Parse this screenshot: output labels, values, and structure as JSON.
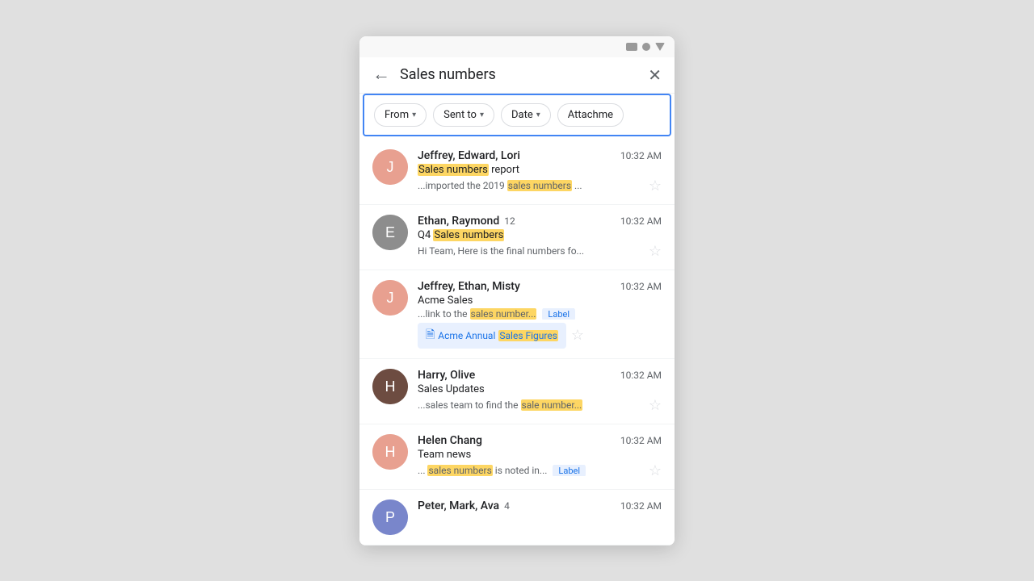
{
  "statusBar": {
    "icons": [
      "rect",
      "circle",
      "triangle"
    ]
  },
  "searchBar": {
    "backLabel": "←",
    "searchText": "Sales numbers",
    "closeLabel": "✕"
  },
  "filterBar": {
    "filters": [
      {
        "label": "From",
        "id": "from"
      },
      {
        "label": "Sent to",
        "id": "sent-to"
      },
      {
        "label": "Date",
        "id": "date"
      },
      {
        "label": "Attachments",
        "id": "attachments"
      }
    ]
  },
  "emails": [
    {
      "id": 1,
      "avatarClass": "avatar-jel",
      "avatarLabel": "J",
      "sender": "Jeffrey, Edward, Lori",
      "count": null,
      "time": "10:32 AM",
      "subject": "Sales numbers report",
      "subjectHighlight": "Sales numbers",
      "subjectRest": " report",
      "preview": "...imported the 2019 ",
      "previewHighlight": "sales numbers",
      "previewRest": "...",
      "labelChip": null,
      "attachment": null,
      "starred": false
    },
    {
      "id": 2,
      "avatarClass": "avatar-er",
      "avatarLabel": "E",
      "sender": "Ethan, Raymond",
      "count": "12",
      "time": "10:32 AM",
      "subject": "Q4 Sales numbers",
      "subjectPrefix": "Q4 ",
      "subjectHighlight": "Sales numbers",
      "subjectRest": "",
      "preview": "Hi Team, Here is the final numbers fo...",
      "previewHighlight": null,
      "previewRest": null,
      "labelChip": null,
      "attachment": null,
      "starred": false
    },
    {
      "id": 3,
      "avatarClass": "avatar-jem",
      "avatarLabel": "J",
      "sender": "Jeffrey, Ethan, Misty",
      "count": null,
      "time": "10:32 AM",
      "subject": "Acme Sales",
      "subjectPrefix": null,
      "subjectHighlight": null,
      "subjectRest": "Acme Sales",
      "preview": "...link to the ",
      "previewHighlight": "sales number...",
      "previewRest": "",
      "labelChip": "Label",
      "attachment": "Acme Annual Sales Figures",
      "attachmentHighlight": "Sales Figures",
      "starred": false
    },
    {
      "id": 4,
      "avatarClass": "avatar-ho",
      "avatarLabel": "H",
      "sender": "Harry, Olive",
      "count": null,
      "time": "10:32 AM",
      "subject": "Sales Updates",
      "subjectPrefix": null,
      "subjectHighlight": null,
      "subjectRest": "Sales Updates",
      "preview": "...sales team to find the ",
      "previewHighlight": "sale number...",
      "previewRest": "",
      "labelChip": null,
      "attachment": null,
      "starred": false
    },
    {
      "id": 5,
      "avatarClass": "avatar-hc",
      "avatarLabel": "H",
      "sender": "Helen Chang",
      "count": null,
      "time": "10:32 AM",
      "subject": "Team news",
      "subjectPrefix": null,
      "subjectHighlight": null,
      "subjectRest": "Team news",
      "preview": "...",
      "previewHighlight": "sales numbers",
      "previewRest": " is noted in...",
      "labelChip": "Label",
      "attachment": null,
      "starred": false
    },
    {
      "id": 6,
      "avatarClass": "avatar-pm",
      "avatarLabel": "P",
      "sender": "Peter, Mark, Ava",
      "count": "4",
      "time": "10:32 AM",
      "subject": "",
      "subjectPrefix": null,
      "subjectHighlight": null,
      "subjectRest": "",
      "preview": "",
      "previewHighlight": null,
      "previewRest": null,
      "labelChip": null,
      "attachment": null,
      "starred": false
    }
  ]
}
